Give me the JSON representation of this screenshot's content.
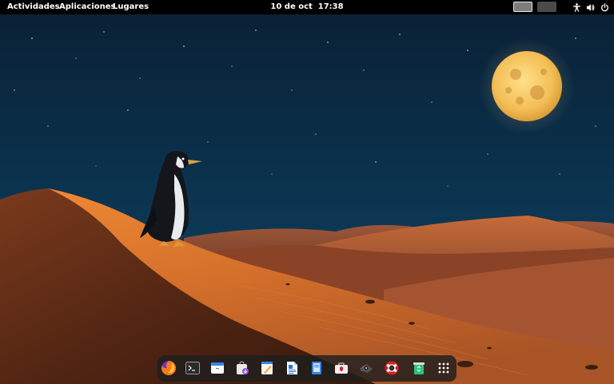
{
  "topbar": {
    "activities_label": "Actividades",
    "applications_label": "Aplicaciones",
    "places_label": "Lugares",
    "date": "10 de oct",
    "time": "17:38",
    "workspaces": [
      {
        "index": 1,
        "active": true
      },
      {
        "index": 2,
        "active": false
      }
    ],
    "tray_icons": [
      "accessibility-icon",
      "volume-icon",
      "power-icon"
    ]
  },
  "wallpaper": {
    "scene": "night-desert-penguin-moon",
    "sky_color": "#0b3450",
    "sand_color": "#c96a2c",
    "moon_color": "#f3c560"
  },
  "dock": {
    "apps": [
      {
        "name": "firefox-icon"
      },
      {
        "name": "terminal-icon"
      },
      {
        "name": "files-icon"
      },
      {
        "name": "software-icon"
      },
      {
        "name": "text-editor-icon"
      },
      {
        "name": "writer-document-icon"
      },
      {
        "name": "document-viewer-icon"
      },
      {
        "name": "toolbox-icon"
      },
      {
        "name": "screenshot-icon"
      },
      {
        "name": "help-icon"
      },
      {
        "name": "trash-icon"
      },
      {
        "name": "show-apps-icon"
      }
    ]
  }
}
